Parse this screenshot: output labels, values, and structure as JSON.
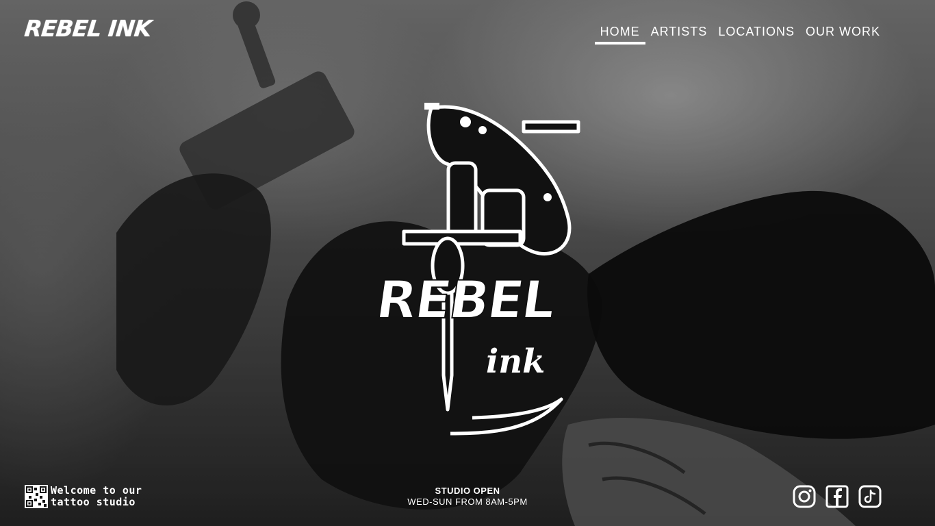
{
  "brand": {
    "name": "REBEL INK"
  },
  "nav": {
    "items": [
      {
        "label": "HOME",
        "active": true
      },
      {
        "label": "ARTISTS",
        "active": false
      },
      {
        "label": "LOCATIONS",
        "active": false
      },
      {
        "label": "OUR WORK",
        "active": false
      }
    ]
  },
  "hero": {
    "logo_title": "REBEL",
    "logo_sub": "ink",
    "logo_icon": "tattoo-machine-icon"
  },
  "footer": {
    "welcome_line1": "Welcome to our",
    "welcome_line2": "tattoo studio",
    "qr_icon": "qr-code-icon",
    "hours_title": "STUDIO OPEN",
    "hours_text": "WED-SUN FROM 8AM-5PM",
    "social": [
      "instagram-icon",
      "facebook-icon",
      "tiktok-icon"
    ]
  }
}
